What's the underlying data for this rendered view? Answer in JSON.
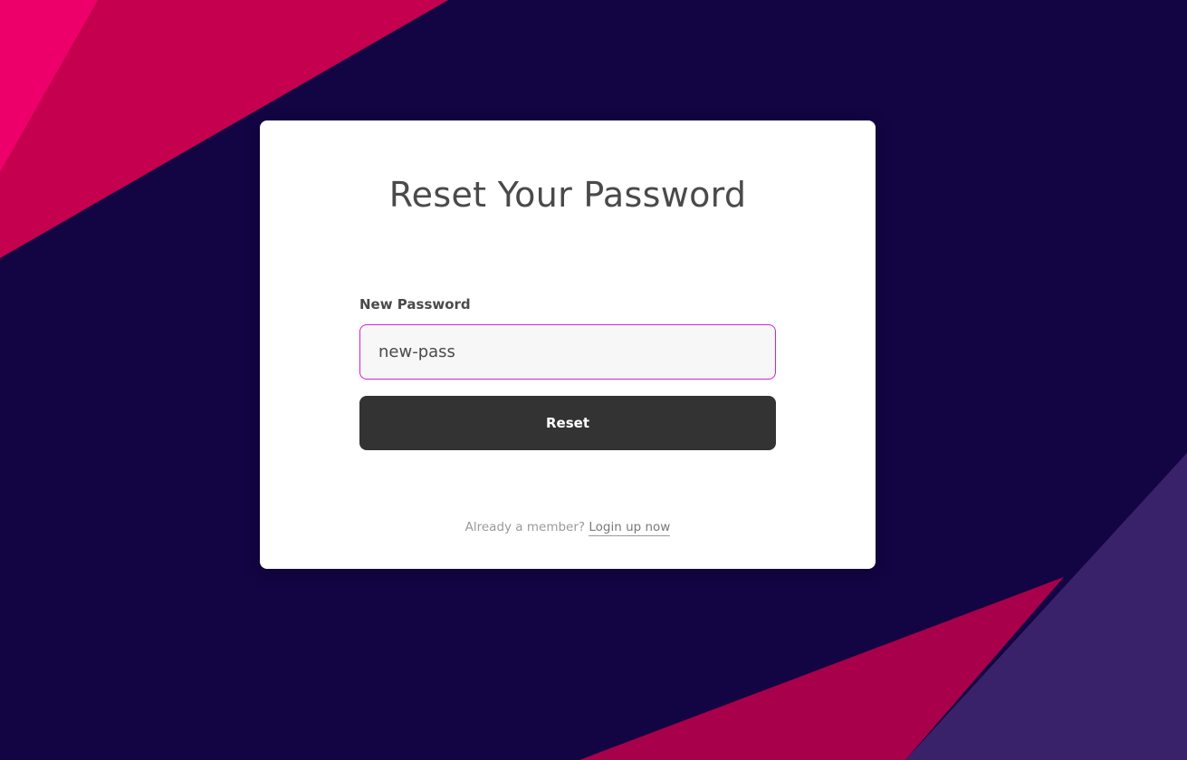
{
  "colors": {
    "background": "#130443",
    "accent_pink": "#e8005f",
    "accent_magenta": "#d61fd6",
    "accent_purple": "#3a226b",
    "button": "#333333"
  },
  "form": {
    "title": "Reset Your Password",
    "password_label": "New Password",
    "password_value": "new-pass",
    "reset_label": "Reset"
  },
  "footer": {
    "prompt": "Already a member?",
    "link_label": "Login up now"
  }
}
